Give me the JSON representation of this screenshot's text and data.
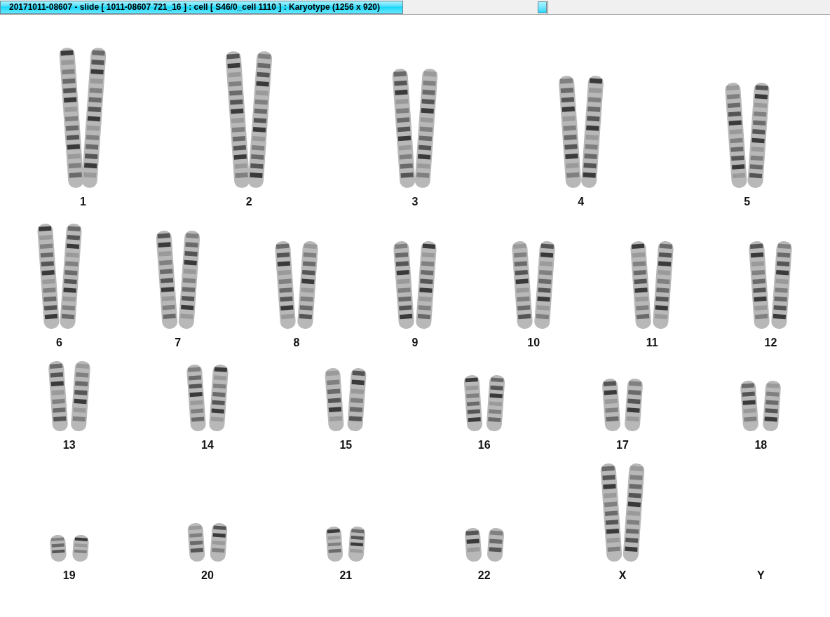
{
  "window": {
    "title": "20171011-08607 - slide [ 1011-08607 721_16 ] : cell [ S46/0_cell 1110 ] : Karyotype  (1256 x 920)"
  },
  "rows": [
    {
      "items": [
        {
          "label": "1",
          "kind": "pair"
        },
        {
          "label": "2",
          "kind": "pair"
        },
        {
          "label": "3",
          "kind": "pair"
        },
        {
          "label": "4",
          "kind": "pair"
        },
        {
          "label": "5",
          "kind": "pair"
        }
      ]
    },
    {
      "items": [
        {
          "label": "6",
          "kind": "pair"
        },
        {
          "label": "7",
          "kind": "pair"
        },
        {
          "label": "8",
          "kind": "pair"
        },
        {
          "label": "9",
          "kind": "pair"
        },
        {
          "label": "10",
          "kind": "pair"
        },
        {
          "label": "11",
          "kind": "pair"
        },
        {
          "label": "12",
          "kind": "pair"
        }
      ]
    },
    {
      "items": [
        {
          "label": "13",
          "kind": "pair"
        },
        {
          "label": "14",
          "kind": "pair"
        },
        {
          "label": "15",
          "kind": "pair"
        },
        {
          "label": "16",
          "kind": "pair"
        },
        {
          "label": "17",
          "kind": "pair"
        },
        {
          "label": "18",
          "kind": "pair"
        }
      ]
    },
    {
      "items": [
        {
          "label": "19",
          "kind": "pair"
        },
        {
          "label": "20",
          "kind": "pair"
        },
        {
          "label": "21",
          "kind": "pair"
        },
        {
          "label": "22",
          "kind": "pair"
        },
        {
          "label": "X",
          "kind": "pair"
        },
        {
          "label": "Y",
          "kind": "none"
        }
      ]
    }
  ]
}
